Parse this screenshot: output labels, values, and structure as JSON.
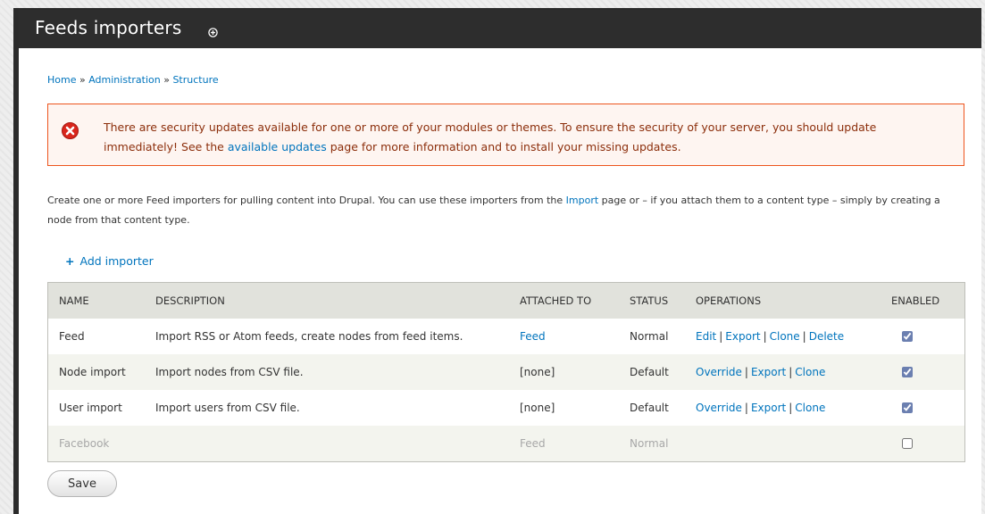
{
  "header": {
    "title": "Feeds importers"
  },
  "breadcrumb": {
    "items": [
      "Home",
      "Administration",
      "Structure"
    ],
    "separator": "»"
  },
  "message": {
    "text_before": "There are security updates available for one or more of your modules or themes. To ensure the security of your server, you should update immediately! See the ",
    "link": "available updates",
    "text_after": " page for more information and to install your missing updates."
  },
  "help": {
    "text_before": "Create one or more Feed importers for pulling content into Drupal. You can use these importers from the ",
    "link": "Import",
    "text_after": " page or – if you attach them to a content type – simply by creating a node from that content type."
  },
  "actions": {
    "add_icon": "+",
    "add_label": "Add importer"
  },
  "table": {
    "headers": [
      "NAME",
      "DESCRIPTION",
      "ATTACHED TO",
      "STATUS",
      "OPERATIONS",
      "ENABLED"
    ],
    "rows": [
      {
        "name": "Feed",
        "description": "Import RSS or Atom feeds, create nodes from feed items.",
        "attached": "Feed",
        "status": "Normal",
        "operations": [
          "Edit",
          "Export",
          "Clone",
          "Delete"
        ],
        "enabled": true
      },
      {
        "name": "Node import",
        "description": "Import nodes from CSV file.",
        "attached": "[none]",
        "status": "Default",
        "operations": [
          "Override",
          "Export",
          "Clone"
        ],
        "enabled": true
      },
      {
        "name": "User import",
        "description": "Import users from CSV file.",
        "attached": "[none]",
        "status": "Default",
        "operations": [
          "Override",
          "Export",
          "Clone"
        ],
        "enabled": true
      },
      {
        "name": "Facebook",
        "description": "",
        "attached": "Feed",
        "status": "Normal",
        "operations": [],
        "enabled": false
      }
    ]
  },
  "form": {
    "save_label": "Save"
  },
  "colors": {
    "link": "#0074bd",
    "header_bar": "#2d2d2d",
    "error_border": "#ed541d",
    "error_bg": "#fef5f1",
    "error_text": "#8c2e0b",
    "disabled_text": "#a8a8a8"
  }
}
